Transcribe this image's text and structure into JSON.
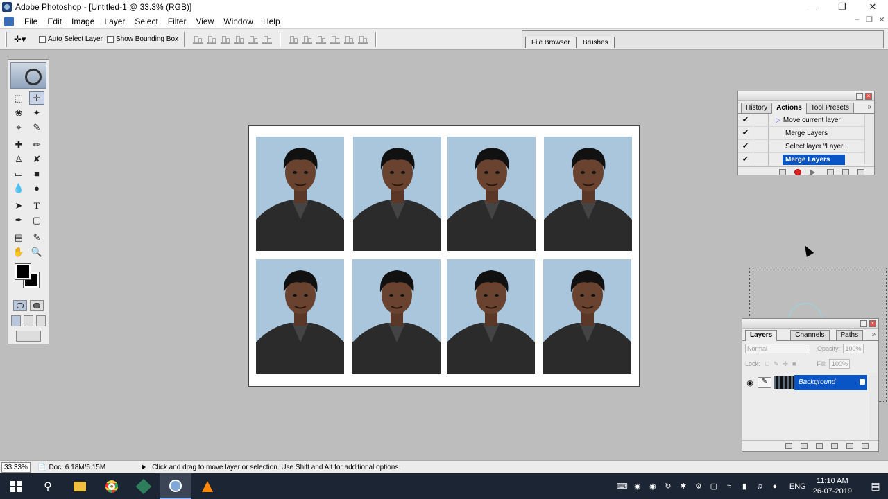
{
  "window": {
    "title": "Adobe Photoshop - [Untitled-1 @ 33.3% (RGB)]",
    "controls": [
      "minimize-icon",
      "restore-icon",
      "close-icon"
    ]
  },
  "menubar": {
    "items": [
      "File",
      "Edit",
      "Image",
      "Layer",
      "Select",
      "Filter",
      "View",
      "Window",
      "Help"
    ]
  },
  "options": {
    "auto_select_layer": "Auto Select Layer",
    "show_bounding_box": "Show Bounding Box",
    "auto_select_checked": false,
    "bounding_box_checked": false
  },
  "palette_well": {
    "tabs": [
      "File Browser",
      "Brushes"
    ]
  },
  "toolbox": {
    "tools": [
      "marquee-icon",
      "move-icon",
      "lasso-icon",
      "magic-wand-icon",
      "crop-icon",
      "slice-icon",
      "healing-brush-icon",
      "brush-icon",
      "clone-stamp-icon",
      "history-brush-icon",
      "eraser-icon",
      "gradient-icon",
      "blur-icon",
      "dodge-icon",
      "path-selection-icon",
      "type-icon",
      "pen-icon",
      "shape-icon",
      "notes-icon",
      "eyedropper-icon",
      "hand-icon",
      "zoom-icon"
    ],
    "foreground_color": "#000000",
    "background_color": "#000000"
  },
  "document": {
    "photo_count": 8,
    "photo_bg_color": "#aac6dd"
  },
  "actions_palette": {
    "tabs": [
      "History",
      "Actions",
      "Tool Presets"
    ],
    "active_tab": "Actions",
    "rows": [
      {
        "checked": "✔",
        "name": "Move current layer",
        "expanded_marker": "▷"
      },
      {
        "checked": "✔",
        "name": "Merge Layers"
      },
      {
        "checked": "✔",
        "name": "Select layer “Layer..."
      },
      {
        "checked": "✔",
        "name": "Merge Layers",
        "selected": true
      }
    ]
  },
  "layers_palette": {
    "tabs": [
      "Layers",
      "Channels",
      "Paths"
    ],
    "active_tab": "Layers",
    "blend_mode": "Normal",
    "opacity_label": "Opacity:",
    "opacity_value": "100%",
    "lock_label": "Lock:",
    "fill_label": "Fill:",
    "fill_value": "100%",
    "layer_name": "Background"
  },
  "statusbar": {
    "zoom": "33.33%",
    "doc": "Doc: 6.18M/6.15M",
    "hint": "Click and drag to move layer or selection.  Use Shift and Alt for additional options."
  },
  "taskbar": {
    "language": "ENG",
    "time": "11:10 AM",
    "date": "26-07-2019"
  }
}
